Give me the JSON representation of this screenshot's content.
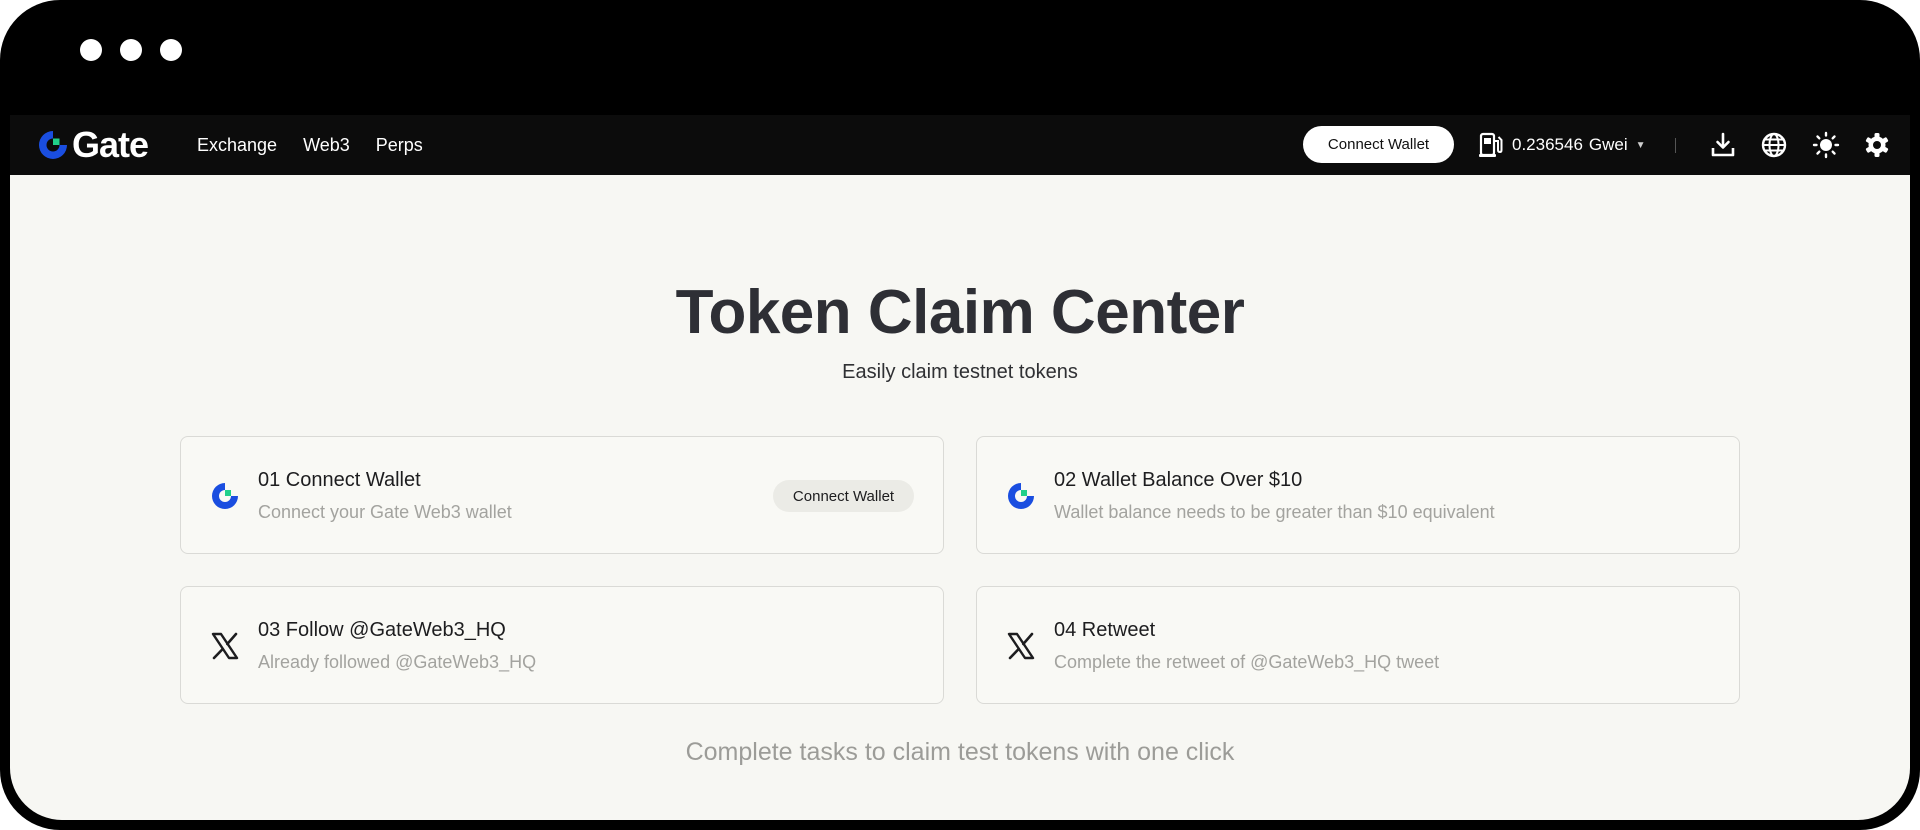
{
  "colors": {
    "brand_blue": "#1a4ee0",
    "brand_green": "#20d08a",
    "topbar_bg": "#0c0c0c",
    "page_bg": "#f7f7f3"
  },
  "topbar": {
    "logo_text": "Gate",
    "nav": [
      "Exchange",
      "Web3",
      "Perps"
    ],
    "connect_wallet": "Connect Wallet",
    "gas": {
      "value": "0.236546",
      "unit": "Gwei",
      "icon": "gas-pump-icon"
    },
    "tools": [
      "download-icon",
      "globe-icon",
      "sun-icon",
      "settings-icon"
    ]
  },
  "hero": {
    "title": "Token Claim Center",
    "subtitle": "Easily claim testnet tokens"
  },
  "tasks": [
    {
      "title": "01 Connect Wallet",
      "desc": "Connect your Gate Web3 wallet",
      "icon": "gate-logo-icon",
      "button": "Connect Wallet"
    },
    {
      "title": "02 Wallet Balance Over $10",
      "desc": "Wallet balance needs to be greater than $10 equivalent",
      "icon": "gate-logo-icon"
    },
    {
      "title": "03 Follow @GateWeb3_HQ",
      "desc": "Already followed @GateWeb3_HQ",
      "icon": "x-logo-icon"
    },
    {
      "title": "04 Retweet",
      "desc": "Complete the retweet of @GateWeb3_HQ tweet",
      "icon": "x-logo-icon"
    }
  ],
  "footer_note": "Complete tasks to claim test tokens with one click"
}
